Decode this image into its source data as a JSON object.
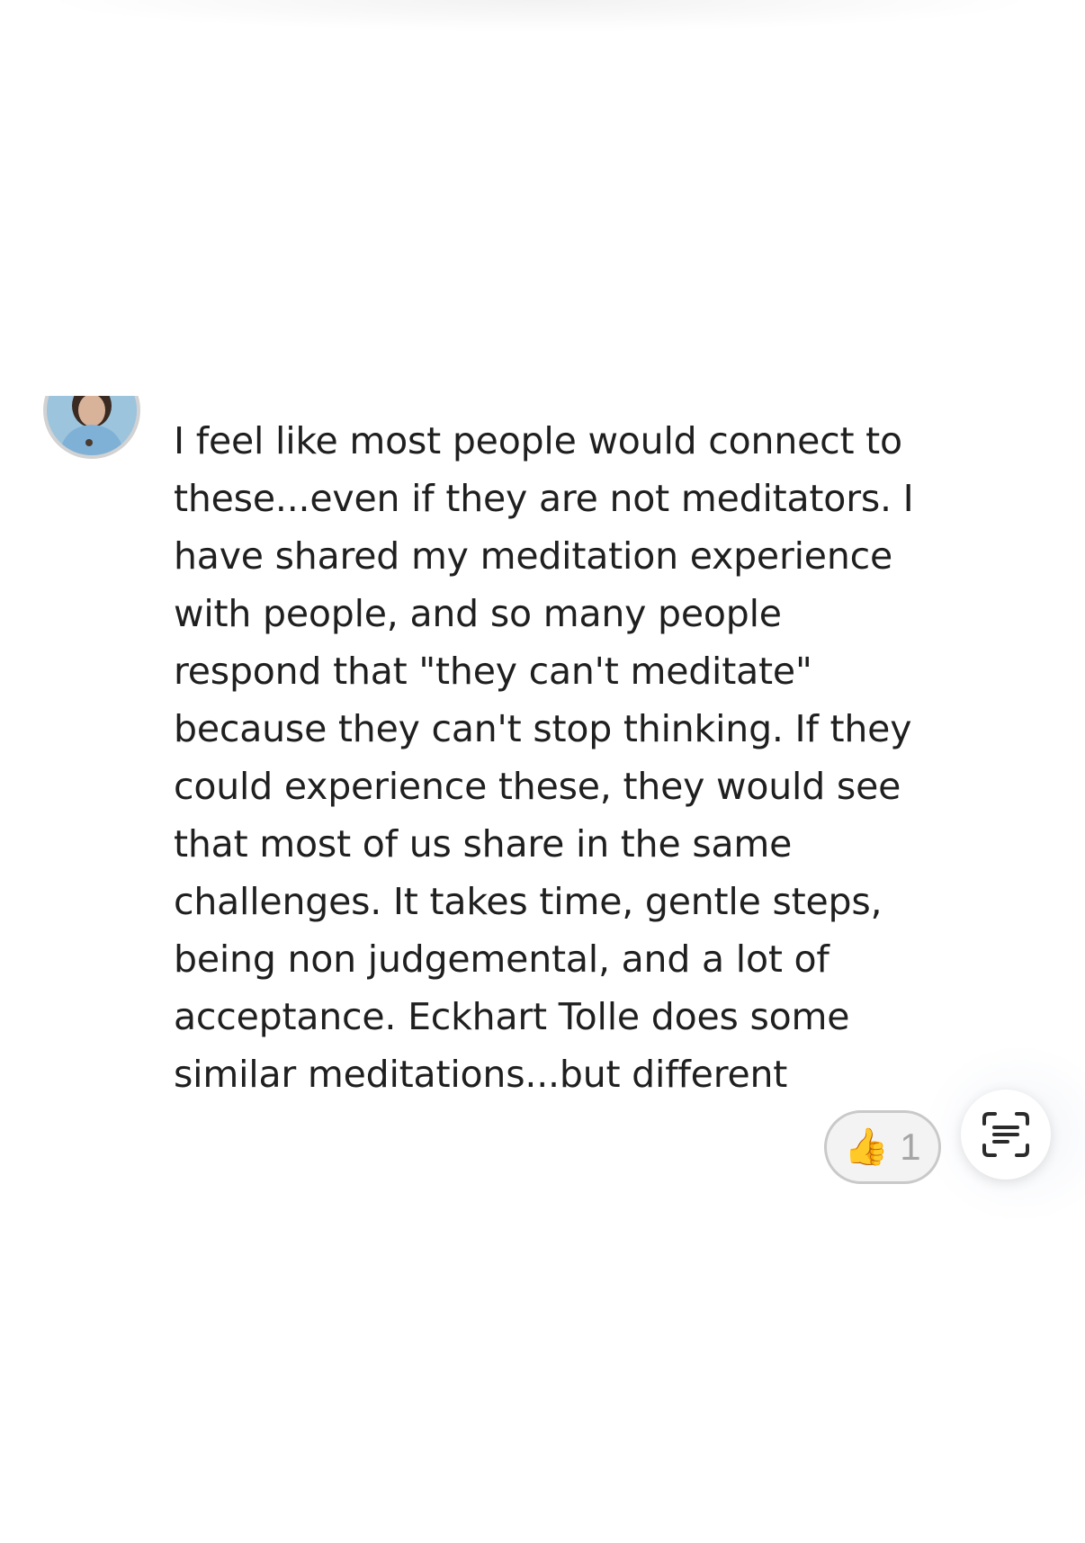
{
  "comment": {
    "text": "I feel like most people would connect to\nthese...even if they are not meditators. I\nhave shared my meditation experience\nwith people, and so many people\nrespond that \"they can't meditate\"\nbecause they can't stop thinking. If they\ncould experience these, they would see\nthat most of us share in the same\nchallenges. It takes time, gentle steps,\nbeing non judgemental, and a lot of\nacceptance. Eckhart Tolle does some\nsimilar meditations...but different",
    "avatar_icon": "user-avatar-photo"
  },
  "reaction": {
    "emoji": "👍",
    "count": "1",
    "icon": "thumbs-up-icon"
  },
  "scan_button": {
    "icon": "text-scan-icon"
  },
  "colors": {
    "text": "#1f1f1f",
    "pill_border": "#c9c9c9",
    "count": "#a5a5a5"
  }
}
